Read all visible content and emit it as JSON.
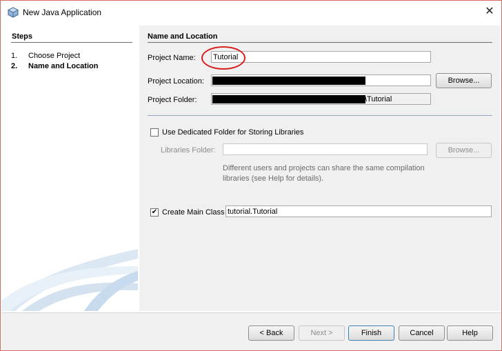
{
  "window": {
    "title": "New Java Application",
    "close_icon": "close-icon"
  },
  "steps": {
    "heading": "Steps",
    "items": [
      {
        "num": "1.",
        "label": "Choose Project",
        "current": false
      },
      {
        "num": "2.",
        "label": "Name and Location",
        "current": true
      }
    ]
  },
  "section": {
    "title": "Name and Location",
    "project_name_label": "Project Name:",
    "project_name_value": "Tutorial",
    "project_location_label": "Project Location:",
    "project_location_value": "",
    "project_folder_label": "Project Folder:",
    "project_folder_suffix": "\\Tutorial",
    "browse_label": "Browse..."
  },
  "libraries": {
    "checkbox_label": "Use Dedicated Folder for Storing Libraries",
    "checked": false,
    "folder_label": "Libraries Folder:",
    "folder_value": "",
    "browse_label": "Browse...",
    "note": "Different users and projects can share the same compilation libraries (see Help for details)."
  },
  "main_class": {
    "checkbox_label": "Create Main Class",
    "checked": true,
    "value": "tutorial.Tutorial"
  },
  "buttons": {
    "back": "< Back",
    "next": "Next >",
    "finish": "Finish",
    "cancel": "Cancel",
    "help": "Help"
  },
  "colors": {
    "highlight_circle": "#d91b1b",
    "panel_bg": "#f0f0f0",
    "window_border": "#d06a5c"
  }
}
